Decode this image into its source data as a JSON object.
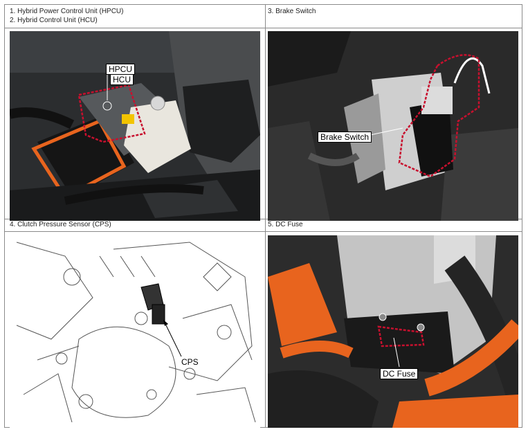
{
  "cells": [
    {
      "header_lines": [
        "1. Hybrid Power Control Unit (HPCU)",
        "2. Hybrid Control Unit (HCU)"
      ],
      "callouts": [
        "HPCU",
        "HCU"
      ]
    },
    {
      "header_lines": [
        "3. Brake Switch"
      ],
      "callouts": [
        "Brake Switch"
      ]
    },
    {
      "header_lines": [
        "4. Clutch Pressure Sensor (CPS)"
      ],
      "callouts": [
        "CPS"
      ]
    },
    {
      "header_lines": [
        "5. DC Fuse"
      ],
      "callouts": [
        "DC Fuse"
      ]
    }
  ],
  "colors": {
    "border": "#8a8a8a",
    "highlight": "#c8102e",
    "hv_cable": "#e8641e"
  }
}
